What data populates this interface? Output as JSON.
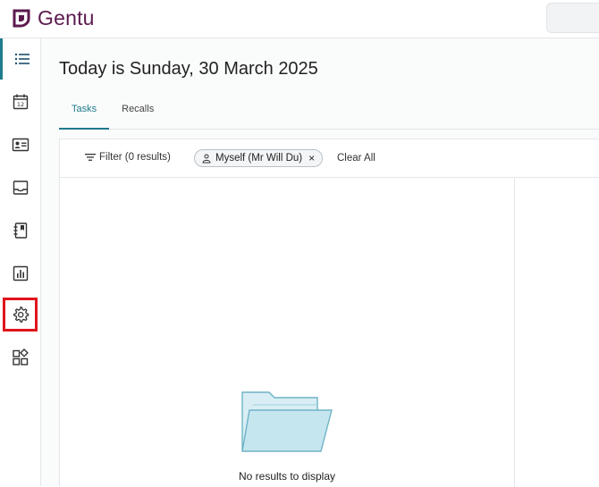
{
  "app": {
    "name": "Gentu",
    "brand_color": "#5b1a4e",
    "accent_color": "#1f7a8c"
  },
  "sidebar": {
    "items": [
      {
        "name": "list-icon",
        "active": true
      },
      {
        "name": "calendar-icon",
        "label": "12"
      },
      {
        "name": "contact-card-icon"
      },
      {
        "name": "inbox-icon"
      },
      {
        "name": "notebook-icon"
      },
      {
        "name": "bar-chart-icon"
      },
      {
        "name": "gear-icon",
        "highlighted": true
      },
      {
        "name": "apps-icon"
      }
    ]
  },
  "main": {
    "title": "Today is Sunday, 30 March 2025",
    "tabs": [
      {
        "label": "Tasks",
        "active": true
      },
      {
        "label": "Recalls"
      }
    ],
    "filter": {
      "label": "Filter (0 results)",
      "chip_label": "Myself (Mr Will Du)",
      "chip_close": "×",
      "clear_all": "Clear All"
    },
    "empty_state": {
      "text": "No results to display",
      "icon": "folder-icon"
    }
  }
}
